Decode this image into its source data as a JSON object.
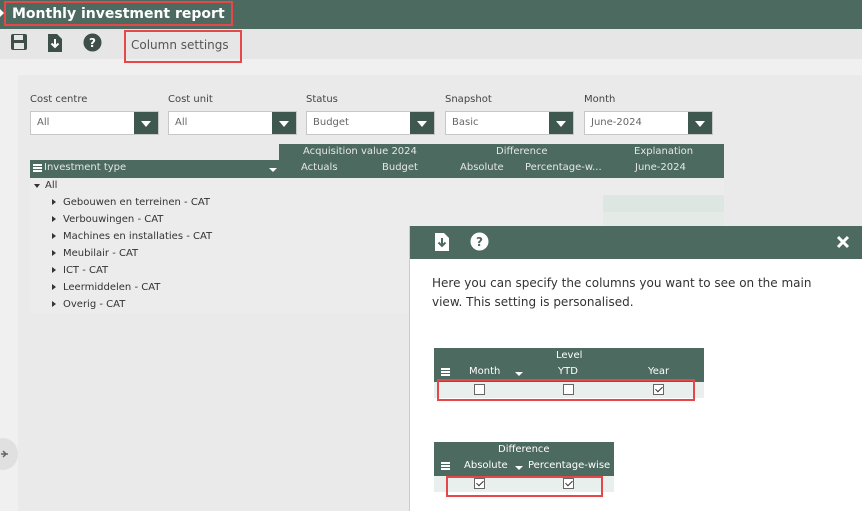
{
  "header": {
    "title": "Monthly investment report"
  },
  "toolbar": {
    "icons": [
      "save-icon",
      "download-icon",
      "help-icon"
    ],
    "column_settings_label": "Column settings"
  },
  "filters": [
    {
      "label": "Cost centre",
      "value": "All"
    },
    {
      "label": "Cost unit",
      "value": "All"
    },
    {
      "label": "Status",
      "value": "Budget"
    },
    {
      "label": "Snapshot",
      "value": "Basic"
    },
    {
      "label": "Month",
      "value": "June-2024"
    }
  ],
  "grid": {
    "group_headers": [
      "Acquisition value 2024",
      "Difference",
      "Explanation"
    ],
    "columns": [
      "Investment type",
      "Actuals",
      "Budget",
      "Absolute",
      "Percentage-w...",
      "June-2024"
    ],
    "root_label": "All",
    "rows": [
      "Gebouwen en terreinen - CAT",
      "Verbouwingen - CAT",
      "Machines en installaties - CAT",
      "Meubilair - CAT",
      "ICT - CAT",
      "Leermiddelen - CAT",
      "Overig - CAT"
    ]
  },
  "dialog": {
    "icons": [
      "download-icon",
      "help-icon",
      "close-icon"
    ],
    "description": "Here you can specify the columns you want to see on the main view. This setting is personalised.",
    "level_table": {
      "group": "Level",
      "columns": [
        "Month",
        "YTD",
        "Year"
      ],
      "checked": [
        false,
        false,
        true
      ]
    },
    "difference_table": {
      "group": "Difference",
      "columns": [
        "Absolute",
        "Percentage-wise"
      ],
      "checked": [
        true,
        true
      ]
    }
  },
  "colors": {
    "header_green": "#4d6a60",
    "highlight_red": "#e44848"
  }
}
